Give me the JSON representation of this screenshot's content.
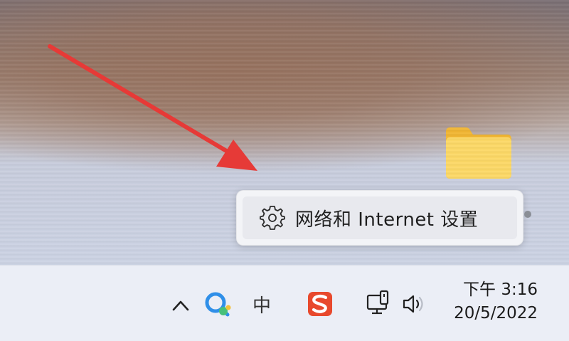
{
  "context_menu": {
    "items": [
      {
        "label": "网络和 Internet 设置",
        "icon": "gear-icon"
      }
    ]
  },
  "taskbar": {
    "tray": {
      "overflow_icon": "chevron-up-icon",
      "qq_icon": "qq-icon",
      "ime_label": "中",
      "sogou_icon": "sogou-icon",
      "network_icon": "network-icon",
      "volume_icon": "volume-icon"
    },
    "clock": {
      "time": "下午 3:16",
      "date": "20/5/2022"
    }
  },
  "desktop": {
    "folder_icon": "folder-icon",
    "annotation": "red-arrow"
  },
  "colors": {
    "arrow": "#e63a37",
    "taskbar_bg": "#ebeef6",
    "menu_bg": "#f3f4f7",
    "sogou": "#e8492d",
    "qq_blue": "#2f8fe8"
  }
}
